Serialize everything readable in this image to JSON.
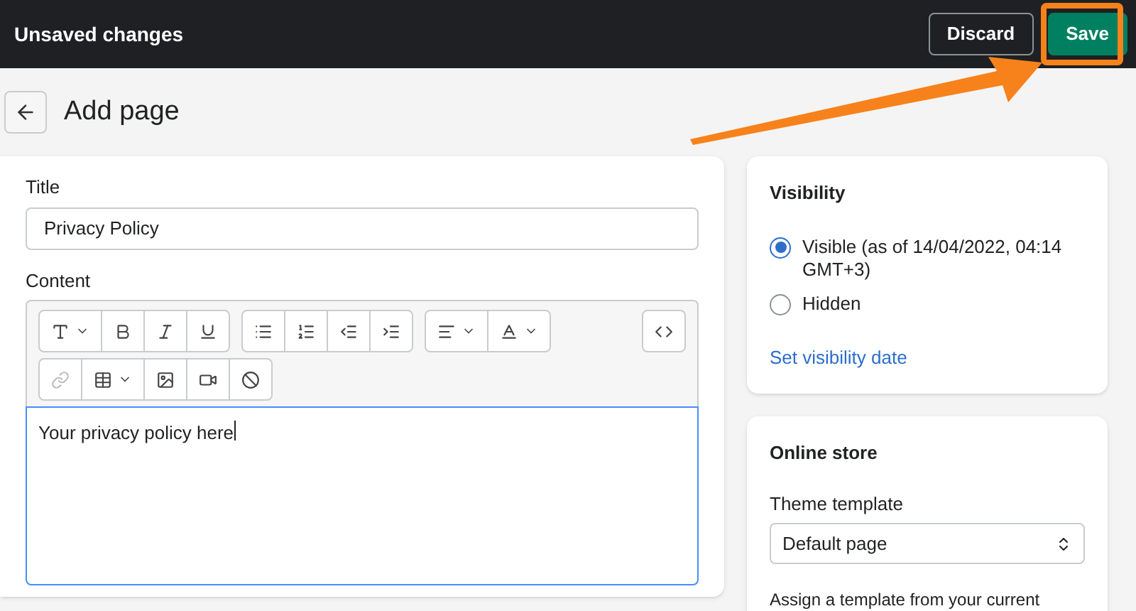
{
  "top_bar": {
    "title": "Unsaved changes",
    "buttons": [
      {
        "label": "Discard",
        "kind": "secondary"
      },
      {
        "label": "Save",
        "kind": "primary"
      }
    ]
  },
  "header": {
    "title": "Add page"
  },
  "page_form": {
    "title_label": "Title",
    "title_value": "Privacy Policy",
    "content_label": "Content",
    "content_text": "Your privacy policy here"
  },
  "visibility": {
    "heading": "Visibility",
    "options": [
      {
        "label": "Visible (as of 14/04/2022, 04:14 GMT+3)",
        "selected": true
      },
      {
        "label": "Hidden",
        "selected": false
      }
    ],
    "link": "Set visibility date"
  },
  "online_store": {
    "heading": "Online store",
    "template_label": "Theme template",
    "template_value": "Default page",
    "help": "Assign a template from your current"
  }
}
